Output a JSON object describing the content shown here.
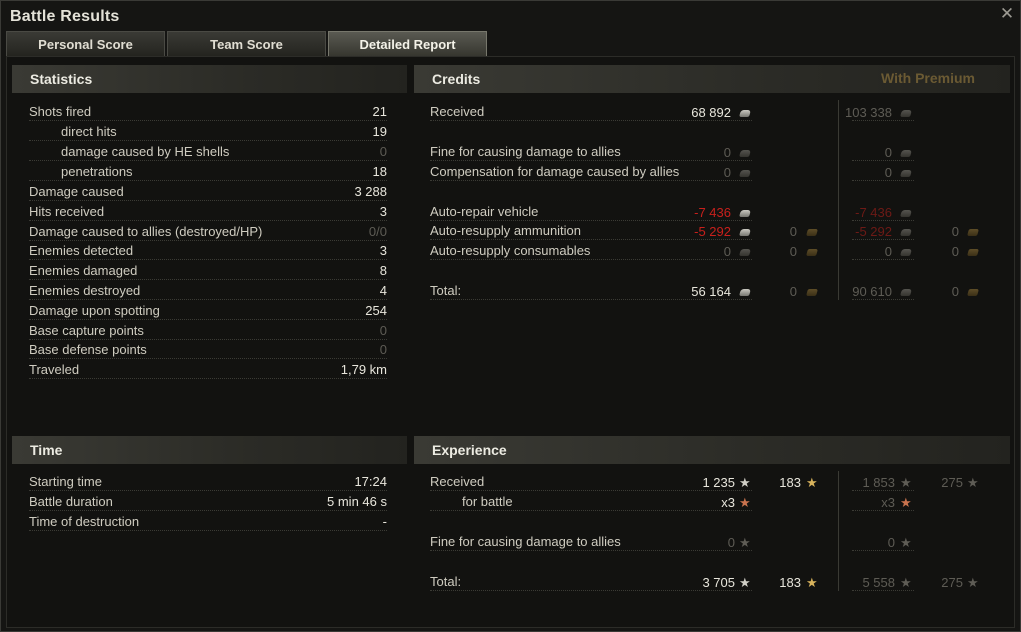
{
  "window": {
    "title": "Battle Results"
  },
  "tabs": [
    "Personal Score",
    "Team Score",
    "Detailed Report"
  ],
  "active_tab": 2,
  "statistics": {
    "header": "Statistics",
    "rows": [
      {
        "label": "Shots fired",
        "value": "21",
        "indent": false,
        "dim": false
      },
      {
        "label": "direct hits",
        "value": "19",
        "indent": true,
        "dim": false
      },
      {
        "label": "damage caused by HE shells",
        "value": "0",
        "indent": true,
        "dim": true
      },
      {
        "label": "penetrations",
        "value": "18",
        "indent": true,
        "dim": false
      },
      {
        "label": "Damage caused",
        "value": "3 288",
        "indent": false,
        "dim": false
      },
      {
        "label": "Hits received",
        "value": "3",
        "indent": false,
        "dim": false
      },
      {
        "label": "Damage caused to allies (destroyed/HP)",
        "value": "0/0",
        "indent": false,
        "dim": true
      },
      {
        "label": "Enemies detected",
        "value": "3",
        "indent": false,
        "dim": false
      },
      {
        "label": "Enemies damaged",
        "value": "8",
        "indent": false,
        "dim": false
      },
      {
        "label": "Enemies destroyed",
        "value": "4",
        "indent": false,
        "dim": false
      },
      {
        "label": "Damage upon spotting",
        "value": "254",
        "indent": false,
        "dim": false
      },
      {
        "label": "Base capture points",
        "value": "0",
        "indent": false,
        "dim": true
      },
      {
        "label": "Base defense points",
        "value": "0",
        "indent": false,
        "dim": true
      },
      {
        "label": "Traveled",
        "value": "1,79 km",
        "indent": false,
        "dim": false
      }
    ]
  },
  "time": {
    "header": "Time",
    "rows": [
      {
        "label": "Starting time",
        "value": "17:24"
      },
      {
        "label": "Battle duration",
        "value": "5 min 46 s"
      },
      {
        "label": "Time of destruction",
        "value": "-"
      }
    ]
  },
  "credits": {
    "header": "Credits",
    "premium_label": "With Premium",
    "rows": [
      {
        "label": "Received",
        "std": "68 892",
        "std_gold": "",
        "prem": "103 338",
        "prem_gold": "",
        "std_style": "",
        "prem_style": "dim"
      },
      {
        "label": "Fine for causing damage to allies",
        "std": "0",
        "std_gold": "",
        "prem": "0",
        "prem_gold": "",
        "std_style": "dim",
        "prem_style": "dim"
      },
      {
        "label": "Compensation for damage caused by allies",
        "std": "0",
        "std_gold": "",
        "prem": "0",
        "prem_gold": "",
        "std_style": "dim",
        "prem_style": "dim"
      },
      {
        "label": "Auto-repair vehicle",
        "std": "-7 436",
        "std_gold": "",
        "prem": "-7 436",
        "prem_gold": "",
        "std_style": "red",
        "prem_style": "redd"
      },
      {
        "label": "Auto-resupply ammunition",
        "std": "-5 292",
        "std_gold": "0",
        "prem": "-5 292",
        "prem_gold": "0",
        "std_style": "red",
        "prem_style": "redd"
      },
      {
        "label": "Auto-resupply consumables",
        "std": "0",
        "std_gold": "0",
        "prem": "0",
        "prem_gold": "0",
        "std_style": "dim",
        "prem_style": "dim"
      },
      {
        "label": "Total:",
        "std": "56 164",
        "std_gold": "0",
        "prem": "90 610",
        "prem_gold": "0",
        "std_style": "",
        "prem_style": "dim"
      }
    ]
  },
  "experience": {
    "header": "Experience",
    "rows": [
      {
        "label": "Received",
        "std": "1 235",
        "std_free": "183",
        "prem": "1 853",
        "prem_free": "275",
        "std_style": "",
        "prem_style": "dim"
      },
      {
        "label": "for battle",
        "std": "x3",
        "std_free": "",
        "prem": "x3",
        "prem_free": "",
        "std_style": "",
        "prem_style": "dim"
      },
      {
        "label": "Fine for causing damage to allies",
        "std": "0",
        "std_free": "",
        "prem": "0",
        "prem_free": "",
        "std_style": "dim",
        "prem_style": "dim"
      },
      {
        "label": "Total:",
        "std": "3 705",
        "std_free": "183",
        "prem": "5 558",
        "prem_free": "275",
        "std_style": "",
        "prem_style": "dim"
      }
    ]
  },
  "colors": {
    "accent_premium": "#6b5a33",
    "negative": "#c8201c",
    "gold": "#d8b35c"
  }
}
